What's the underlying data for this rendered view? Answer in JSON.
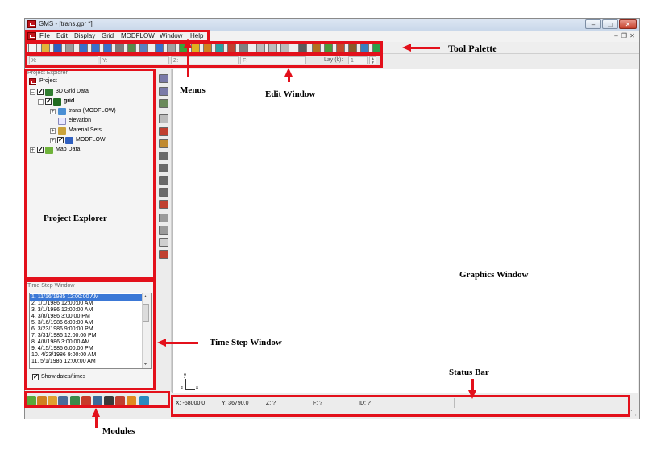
{
  "window": {
    "title": "GMS - [trans.gpr *]"
  },
  "menus": [
    "File",
    "Edit",
    "Display",
    "Grid",
    "MODFLOW",
    "Window",
    "Help"
  ],
  "edit_window": {
    "x_label": "X:",
    "y_label": "Y:",
    "z_label": "Z:",
    "f_label": "F:",
    "lay_label": "Lay (k):",
    "lay_value": "1"
  },
  "project_explorer": {
    "title": "Project Explorer",
    "items": [
      "Project",
      "3D Grid Data",
      "grid",
      "trans (MODFLOW)",
      "elevation",
      "Material Sets",
      "MODFLOW",
      "Map Data"
    ]
  },
  "time_step_window": {
    "title": "Time Step Window",
    "steps": [
      "1.  11/16/1985 12:00:00 AM",
      "2.  1/1/1986 12:00:00 AM",
      "3.  3/1/1986 12:00:00 AM",
      "4.  3/8/1986 3:00:00 PM",
      "5.  3/16/1986 6:00:00 AM",
      "6.  3/23/1986 9:00:00 PM",
      "7.  3/31/1986 12:00:00 PM",
      "8.  4/8/1986 3:00:00 AM",
      "9.  4/15/1986 6:00:00 PM",
      "10.  4/23/1986 9:00:00 AM",
      "11.  5/1/1986 12:00:00 AM"
    ],
    "show_dates_label": "Show dates/times",
    "show_dates_checked": true
  },
  "status_bar": {
    "x": "X: -58000.0",
    "y": "Y: 36790.0",
    "z": "Z: ?",
    "f": "F: ?",
    "id": "ID: ?"
  },
  "annotations": {
    "tool_palette": "Tool Palette",
    "menus": "Menus",
    "edit_window": "Edit Window",
    "project_explorer": "Project Explorer",
    "graphics_window": "Graphics Window",
    "time_step_window": "Time Step Window",
    "status_bar": "Status Bar",
    "modules": "Modules"
  },
  "colors": {
    "highlight": "#e3101b",
    "selection": "#3b78d6",
    "app_icon": "#c0141c"
  },
  "icons": {
    "toolbar": [
      "new-icon",
      "open-icon",
      "save-icon",
      "print-icon",
      "cube-icon",
      "cube-icon",
      "cube-icon",
      "cube-icon",
      "rotate-icon",
      "zoom-icon",
      "help-icon",
      "copy-icon",
      "display-icon",
      "contour-icon",
      "bar-chart-icon",
      "film-icon",
      "grid-icon",
      "table-icon",
      "cell-select-icon",
      "cell-select-icon",
      "cell-select-icon",
      "column-icon",
      "module-icon",
      "module-icon",
      "module-icon",
      "module-icon",
      "module-icon",
      "flag-icon"
    ],
    "vertical_toolbar": [
      "pan-icon",
      "zoom-icon",
      "rotate-icon",
      "select-cell-icon",
      "select-point-icon",
      "select-layer-icon",
      "select-face-icon",
      "select-block-icon",
      "select-row-icon",
      "select-col-icon",
      "create-point-icon",
      "frame-icon",
      "frame-icon",
      "frame-icon",
      "erase-icon"
    ],
    "modules": [
      "mesh-module-icon",
      "borehole-module-icon",
      "tin-module-icon",
      "solid-module-icon",
      "grid-module-icon",
      "scatter-module-icon",
      "map-module-icon",
      "3d-grid-module-icon",
      "uzf-module-icon",
      "gis-module-icon",
      "globe-module-icon"
    ]
  }
}
